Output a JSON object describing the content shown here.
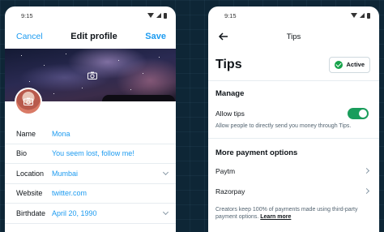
{
  "left": {
    "status": {
      "time": "9:15"
    },
    "header": {
      "cancel": "Cancel",
      "title": "Edit profile",
      "save": "Save"
    },
    "icons": {
      "banner_camera": "camera-icon",
      "avatar_camera": "camera-icon"
    },
    "fields": [
      {
        "label": "Name",
        "value": "Mona"
      },
      {
        "label": "Bio",
        "value": "You seem lost, follow me!"
      },
      {
        "label": "Location",
        "value": "Mumbai"
      },
      {
        "label": "Website",
        "value": "twitter.com"
      },
      {
        "label": "Birthdate",
        "value": "April 20, 1990"
      }
    ]
  },
  "right": {
    "status": {
      "time": "9:15"
    },
    "header": {
      "title": "Tips"
    },
    "page_title": "Tips",
    "badge": "Active",
    "manage": {
      "title": "Manage",
      "allow_label": "Allow tips",
      "allow_on": true,
      "description": "Allow people to directly send you money through Tips."
    },
    "more": {
      "title": "More payment options",
      "options": [
        "Paytm",
        "Razorpay"
      ],
      "footnote": "Creators keep 100% of payments made using third-party payment options.",
      "learn_more": "Learn more"
    }
  },
  "colors": {
    "accent": "#1d9bf0",
    "toggle_on": "#1a9d5c",
    "active_check": "#16a34a",
    "background": "#0e2636"
  }
}
